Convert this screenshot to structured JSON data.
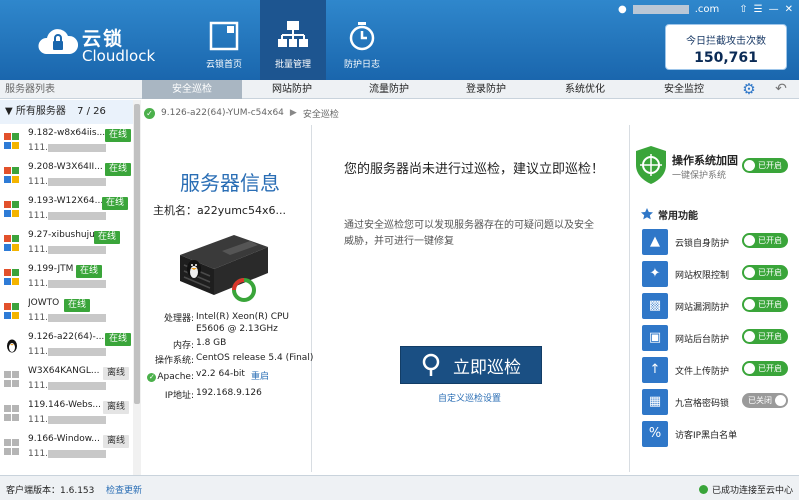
{
  "app": {
    "logo_cn": "云锁",
    "logo_en": "Cloudlock"
  },
  "nav": [
    {
      "label": "云锁首页",
      "icon": "home-panel-icon"
    },
    {
      "label": "批量管理",
      "icon": "network-hierarchy-icon",
      "active": true
    },
    {
      "label": "防护日志",
      "icon": "stopwatch-log-icon"
    }
  ],
  "topbar": {
    "account_suffix": ".com"
  },
  "attack": {
    "title": "今日拦截攻击次数",
    "count": "150,761"
  },
  "tabs": {
    "side_header": "服务器列表",
    "items": [
      "安全巡检",
      "网站防护",
      "流量防护",
      "登录防护",
      "系统优化",
      "安全监控"
    ],
    "active_index": 0
  },
  "sidebar": {
    "header": "所有服务器",
    "count": "7 / 26",
    "servers": [
      {
        "name": "9.182-w8x64iis...",
        "ip": "111.",
        "status": "在线",
        "online": true,
        "os": "windows"
      },
      {
        "name": "9.208-W3X64II...",
        "ip": "111.",
        "status": "在线",
        "online": true,
        "os": "windows"
      },
      {
        "name": "9.193-W12X64...",
        "ip": "111.",
        "status": "在线",
        "online": true,
        "os": "windows"
      },
      {
        "name": "9.27-xibushuju",
        "ip": "111.",
        "status": "在线",
        "online": true,
        "os": "windows"
      },
      {
        "name": "9.199-JTM",
        "ip": "111.",
        "status": "在线",
        "online": true,
        "os": "windows"
      },
      {
        "name": "JOWTO",
        "ip": "111.",
        "status": "在线",
        "online": true,
        "os": "windows"
      },
      {
        "name": "9.126-a22(64)-...",
        "ip": "111.",
        "status": "在线",
        "online": true,
        "os": "linux"
      },
      {
        "name": "W3X64KANGL...",
        "ip": "111.",
        "status": "离线",
        "online": false,
        "os": "windows"
      },
      {
        "name": "119.146-Webs...",
        "ip": "111.",
        "status": "离线",
        "online": false,
        "os": "windows"
      },
      {
        "name": "9.166-Window...",
        "ip": "111.",
        "status": "离线",
        "online": false,
        "os": "windows"
      }
    ]
  },
  "breadcrumb": {
    "server": "9.126-a22(64)-YUM-c54x64",
    "section": "安全巡检"
  },
  "server_info": {
    "title": "服务器信息",
    "hostname_label": "主机名：",
    "hostname": "a22yumc54x6...",
    "specs": [
      {
        "key": "处理器:",
        "value": "Intel(R) Xeon(R) CPU E5606 @ 2.13GHz"
      },
      {
        "key": "内存:",
        "value": "1.8 GB"
      },
      {
        "key": "操作系统:",
        "value": "CentOS release 5.4 (Final)"
      },
      {
        "key": "Apache:",
        "value": "v2.2 64-bit",
        "action": "重启"
      },
      {
        "key": "IP地址:",
        "value": "192.168.9.126"
      }
    ]
  },
  "scan": {
    "message": "您的服务器尚未进行过巡检，建议立即巡检！",
    "description": "通过安全巡检您可以发现服务器存在的可疑问题以及安全威胁，并可进行一键修复",
    "button": "立即巡检",
    "custom_link": "自定义巡检设置"
  },
  "os_harden": {
    "title": "操作系统加固",
    "subtitle": "一键保护系统",
    "toggle": "已开启"
  },
  "functions": {
    "title": "常用功能",
    "items": [
      {
        "label": "云锁自身防护",
        "icon": "cloud-shield-icon",
        "toggle": "已开启",
        "on": true
      },
      {
        "label": "网站权限控制",
        "icon": "web-permission-icon",
        "toggle": "已开启",
        "on": true
      },
      {
        "label": "网站漏洞防护",
        "icon": "vulnerability-icon",
        "toggle": "已开启",
        "on": true
      },
      {
        "label": "网站后台防护",
        "icon": "backend-icon",
        "toggle": "已开启",
        "on": true
      },
      {
        "label": "文件上传防护",
        "icon": "upload-icon",
        "toggle": "已开启",
        "on": true
      },
      {
        "label": "九宫格密码锁",
        "icon": "grid-lock-icon",
        "toggle": "已关闭",
        "on": false
      },
      {
        "label": "访客IP黑白名单",
        "icon": "ip-list-icon"
      }
    ]
  },
  "status_bar": {
    "version_label": "客户端版本：",
    "version": "1.6.153",
    "update": "检查更新",
    "connection": "已成功连接至云中心"
  },
  "colors": {
    "header": "#1a66ad",
    "online": "#3aa53a",
    "accent": "#2a6eb5",
    "scan_button": "#1a4f83"
  }
}
